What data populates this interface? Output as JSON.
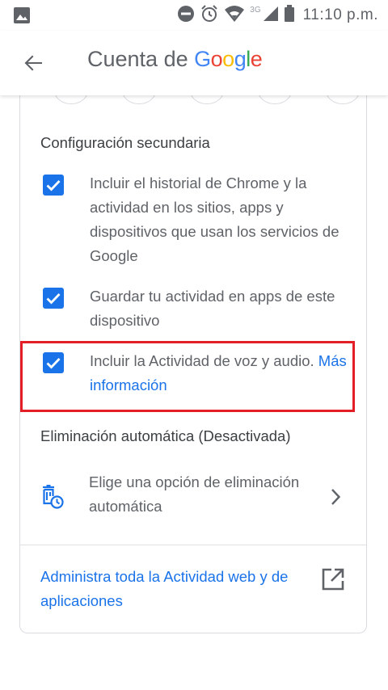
{
  "status_bar": {
    "time": "11:10 p.m.",
    "network": "3G",
    "icons": [
      "image-icon",
      "do-not-disturb-icon",
      "alarm-icon",
      "wifi-icon",
      "signal-icon",
      "battery-icon"
    ]
  },
  "app_bar": {
    "title_prefix": "Cuenta de",
    "title_brand": [
      "G",
      "o",
      "o",
      "g",
      "l",
      "e"
    ],
    "brand_colors": [
      "#4285F4",
      "#EA4335",
      "#FBBC05",
      "#4285F4",
      "#34A853",
      "#EA4335"
    ],
    "back_icon": "arrow-back-icon"
  },
  "secondary_settings": {
    "title": "Configuración secundaria",
    "items": [
      {
        "label": "Incluir el historial de Chrome y la actividad en los sitios, apps y dispositivos que usan los servicios de Google",
        "checked": true
      },
      {
        "label": "Guardar tu actividad en apps de este dispositivo",
        "checked": true
      },
      {
        "label": "Incluir la Actividad de voz y audio.",
        "link": "Más información",
        "checked": true
      }
    ]
  },
  "auto_delete": {
    "title": "Eliminación automática (Desactivada)",
    "option_label": "Elige una opción de eliminación automática",
    "icon": "auto-delete-icon"
  },
  "footer": {
    "manage_link": "Administra toda la Actividad web y de aplicaciones",
    "icon": "open-in-new-icon"
  },
  "colors": {
    "accent": "#1a73e8",
    "highlight": "#e41e26",
    "text": "#5f6368"
  }
}
